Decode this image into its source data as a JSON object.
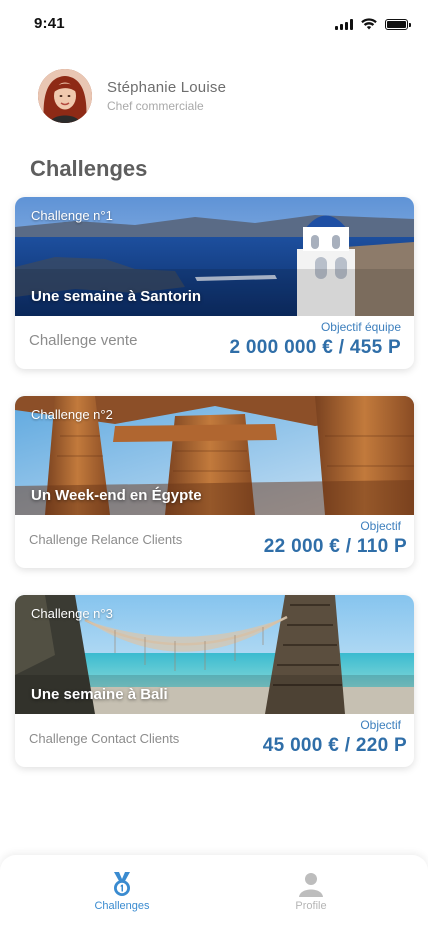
{
  "status_bar": {
    "time": "9:41"
  },
  "profile": {
    "name": "Stéphanie Louise",
    "role": "Chef commerciale"
  },
  "section_title": "Challenges",
  "challenges": [
    {
      "number": "Challenge n°1",
      "title": "Une semaine à Santorin",
      "type": "Challenge vente",
      "goal_label": "Objectif équipe",
      "goal_value": "2 000 000 € / 455 P"
    },
    {
      "number": "Challenge n°2",
      "title": "Un Week-end en Égypte",
      "type": "Challenge Relance Clients",
      "goal_label": "Objectif",
      "goal_value": "22 000 € / 110 P"
    },
    {
      "number": "Challenge n°3",
      "title": "Une semaine à Bali",
      "type": "Challenge Contact Clients",
      "goal_label": "Objectif",
      "goal_value": "45 000 € / 220 P"
    }
  ],
  "tab_bar": {
    "tabs": [
      {
        "label": "Challenges",
        "icon": "medal-icon",
        "active": true
      },
      {
        "label": "Profile",
        "icon": "user-icon",
        "active": false
      }
    ]
  },
  "colors": {
    "accent": "#2f6ea8",
    "accent_light": "#3a8bd0",
    "inactive": "#b5b5b5"
  }
}
